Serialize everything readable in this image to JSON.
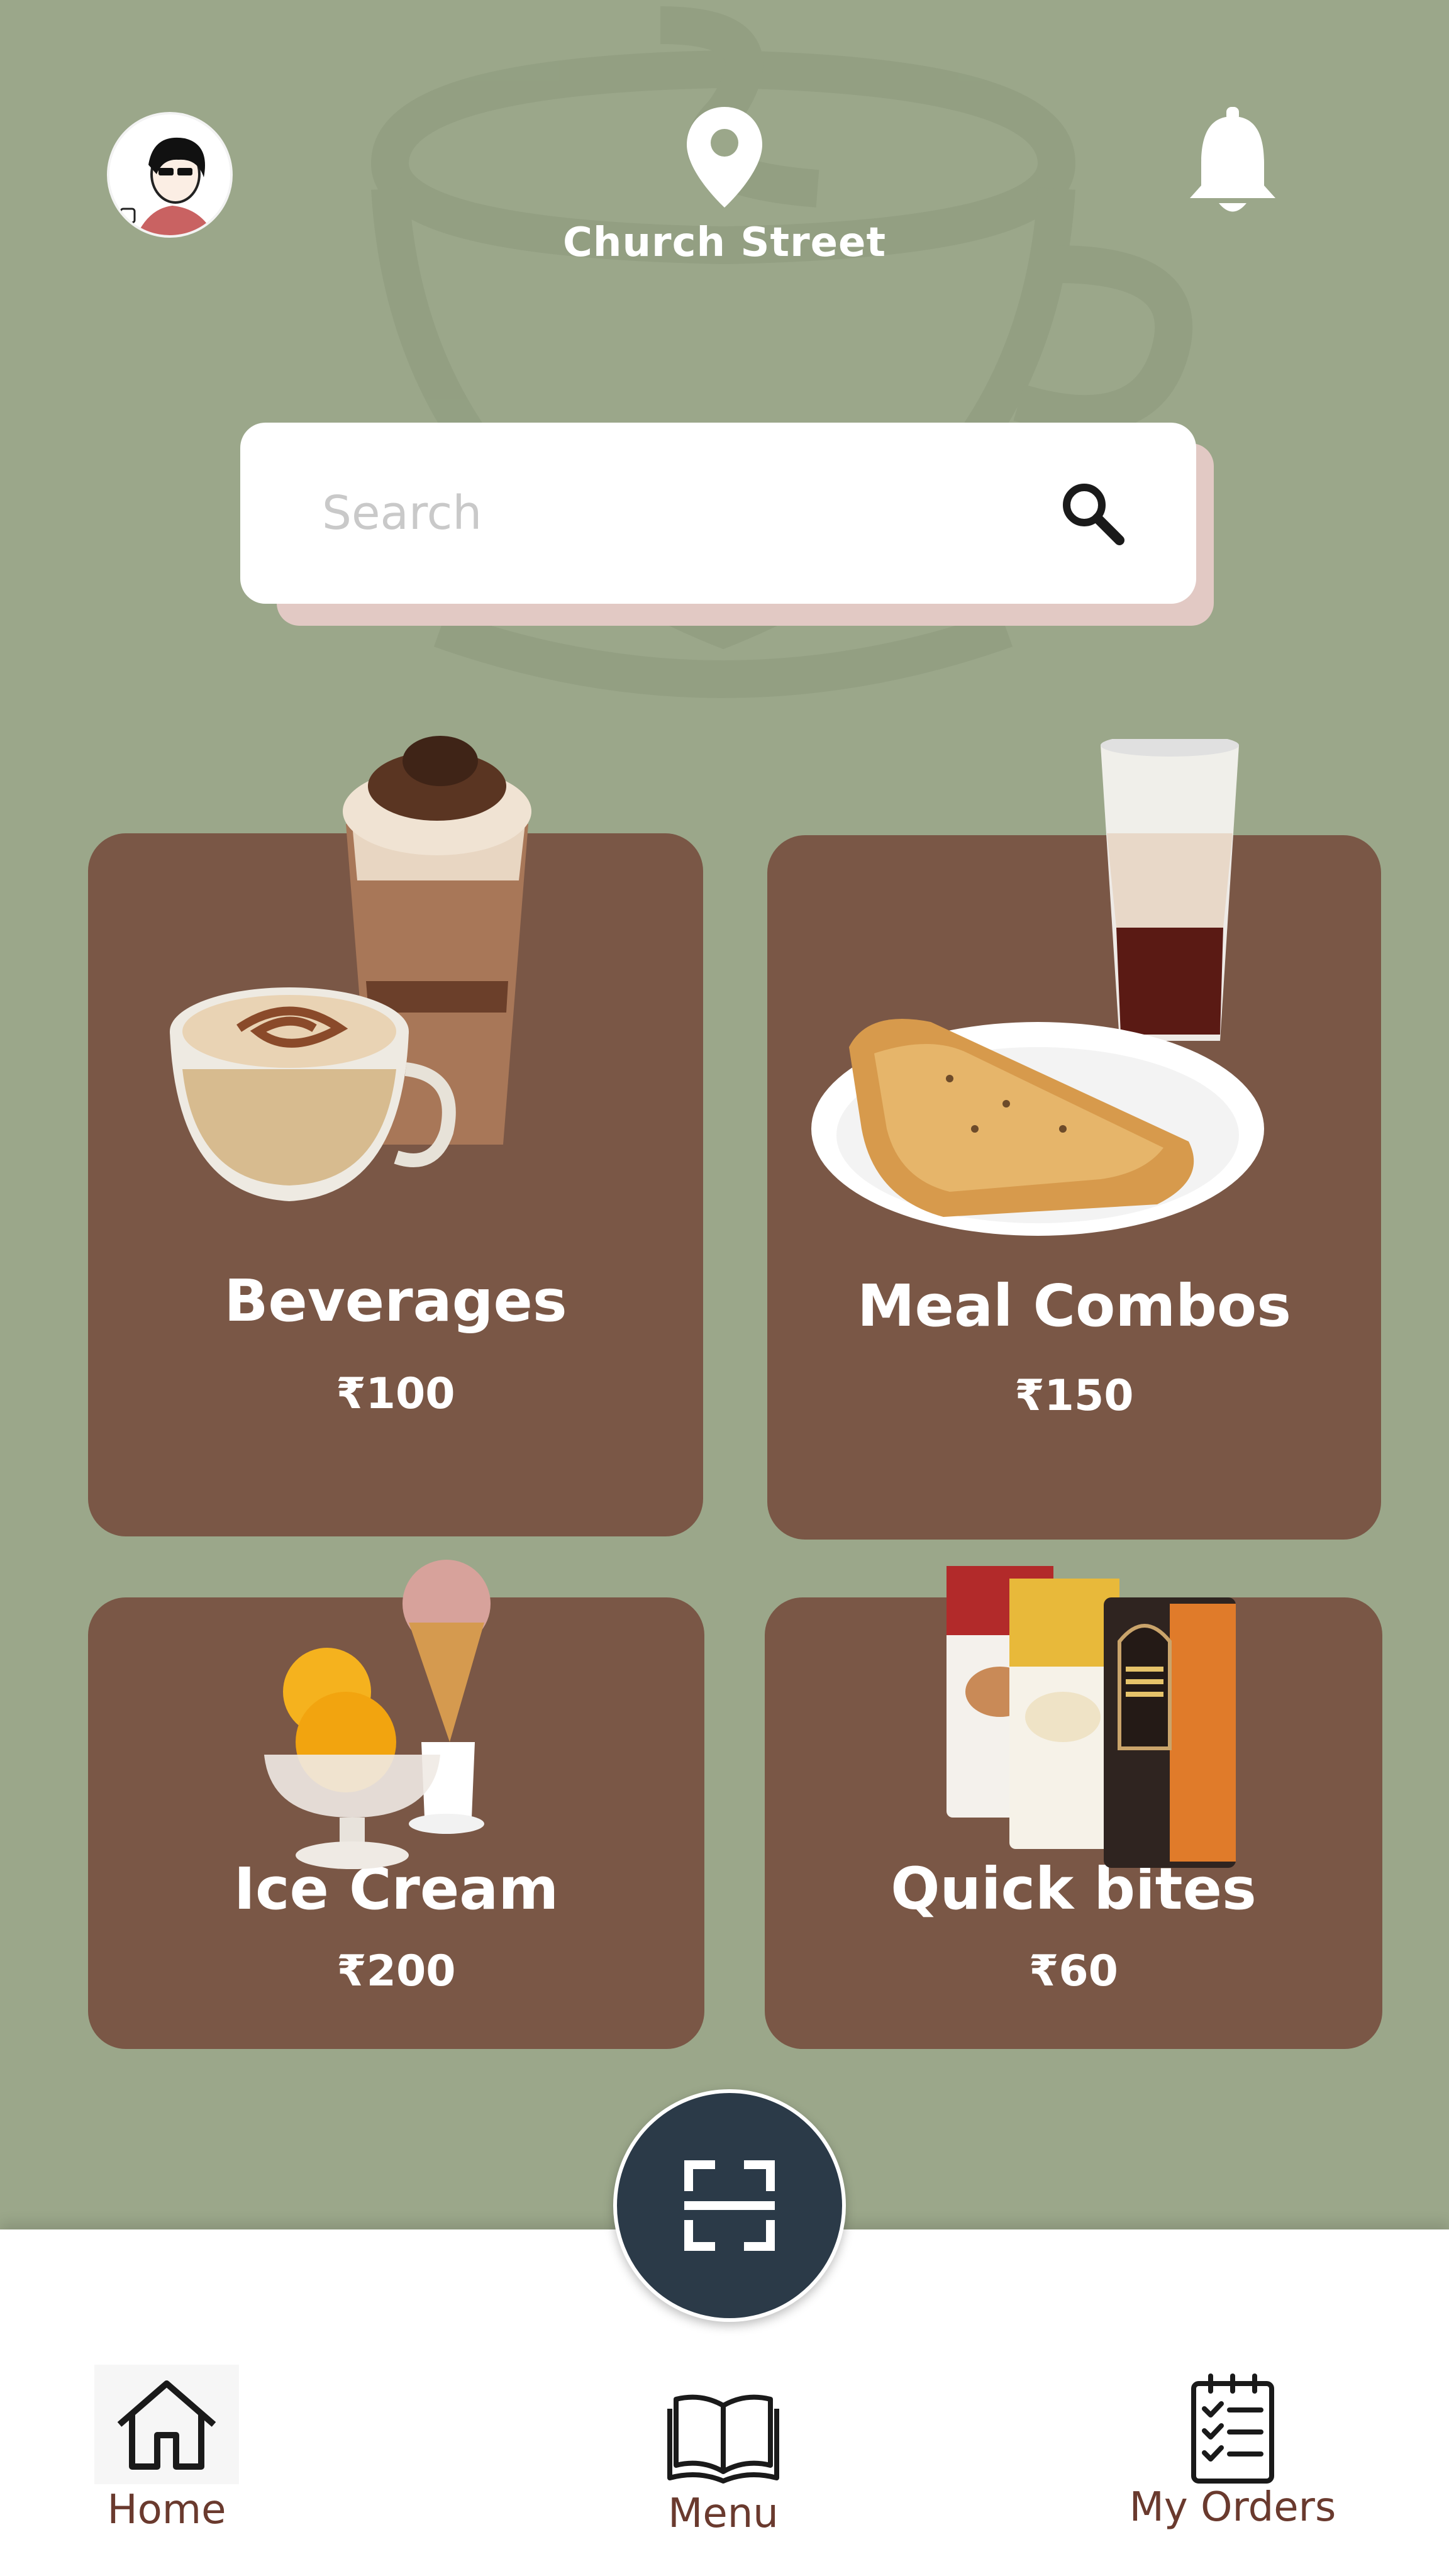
{
  "header": {
    "avatar_icon": "user-avatar",
    "location_icon": "map-pin-icon",
    "location_label": "Church Street",
    "notification_icon": "bell-icon"
  },
  "search": {
    "placeholder": "Search",
    "icon": "search-icon"
  },
  "categories": [
    {
      "title": "Beverages",
      "price": "₹100",
      "image": "coffee-and-frappe"
    },
    {
      "title": "Meal Combos",
      "price": "₹150",
      "image": "puff-and-iced-drink"
    },
    {
      "title": "Ice Cream",
      "price": "₹200",
      "image": "ice-cream-scoops-and-cone"
    },
    {
      "title": "Quick bites",
      "price": "₹60",
      "image": "snack-packets"
    }
  ],
  "scan_button": {
    "icon": "scan-icon"
  },
  "bottom_nav": [
    {
      "label": "Home",
      "icon": "home-icon",
      "active": true
    },
    {
      "label": "Menu",
      "icon": "book-icon"
    },
    {
      "label": "My Orders",
      "icon": "checklist-icon"
    }
  ],
  "colors": {
    "background": "#9ba78a",
    "card": "#7a5746",
    "scan_button": "#2b3a48",
    "nav_label": "#6a3a2e"
  }
}
